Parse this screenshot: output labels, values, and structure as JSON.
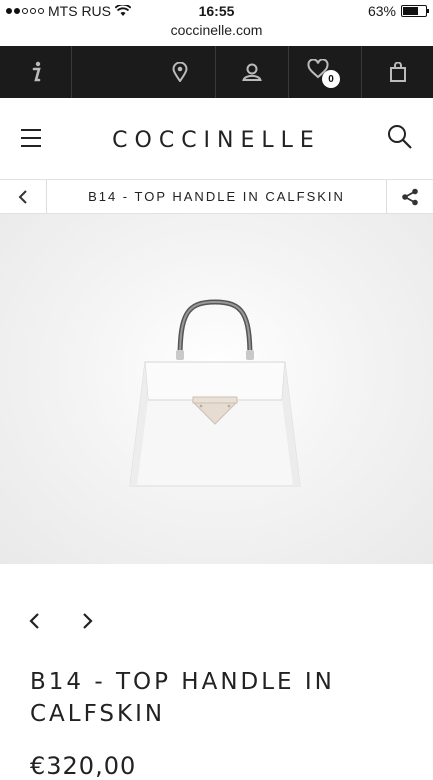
{
  "status_bar": {
    "carrier": "MTS RUS",
    "signal_bars_filled": 2,
    "signal_bars_total": 5,
    "time": "16:55",
    "battery": "63%",
    "battery_level": 0.63
  },
  "browser": {
    "url": "coccinelle.com"
  },
  "top_nav": {
    "info_icon": "info-icon",
    "store_icon": "location-pin-icon",
    "account_icon": "user-icon",
    "wishlist_icon": "heart-icon",
    "wishlist_count": "0",
    "cart_icon": "shopping-bag-icon",
    "background": "#1b1b1b"
  },
  "header": {
    "logo": "COCCINELLE",
    "menu_icon": "hamburger-menu-icon",
    "search_icon": "search-icon"
  },
  "breadcrumb": {
    "back_icon": "chevron-left-icon",
    "title": "B14 - TOP HANDLE IN CALFSKIN",
    "share_icon": "share-icon"
  },
  "product": {
    "image_alt": "white handbag",
    "prev_icon": "chevron-left-icon",
    "next_icon": "chevron-right-icon",
    "name": "B14 - TOP HANDLE IN CALFSKIN",
    "price": "€320,00"
  }
}
